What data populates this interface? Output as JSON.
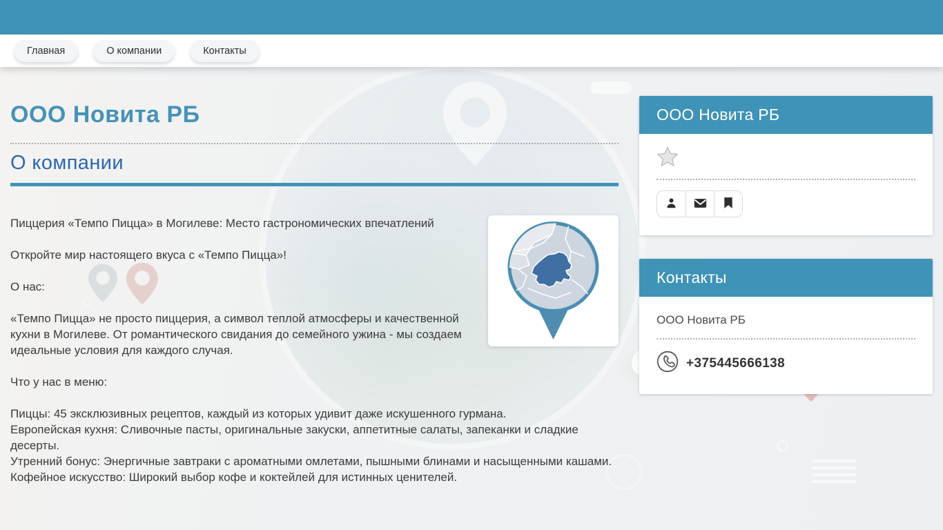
{
  "colors": {
    "accent_teal": "#3e93b7",
    "title_teal": "#4692b8",
    "heading_blue": "#2b68b1",
    "body_text": "#3b3b3b",
    "map_land": "#cdd5df",
    "map_highlight": "#3f6fa3",
    "pin_red": "#cd6a63"
  },
  "nav": {
    "items": [
      {
        "label": "Главная"
      },
      {
        "label": "О компании"
      },
      {
        "label": "Контакты"
      }
    ]
  },
  "main": {
    "title": "ООО Новита РБ",
    "section_heading": "О компании",
    "paragraphs": {
      "p1": "Пиццерия «Темпо Пицца» в Могилеве: Место гастрономических впечатлений",
      "p2": "Откройте мир настоящего вкуса с «Темпо Пицца»!",
      "p3": "О нас:",
      "p4": "«Темпо Пицца» не просто пиццерия, а символ теплой атмосферы и качественной кухни в Могилеве. От романтического свидания до семейного ужина - мы создаем идеальные условия для каждого случая.",
      "p5": "Что у нас в меню:",
      "menu": "Пиццы: 45 эксклюзивных рецептов, каждый из которых удивит даже искушенного гурмана.\nЕвропейская кухня: Сливочные пасты, оригинальные закуски, аппетитные салаты, запеканки и сладкие десерты.\nУтренний бонус: Энергичные завтраки с ароматными омлетами, пышными блинами и насыщенными кашами.\nКофейное искусство: Широкий выбор кофе и коктейлей для истинных ценителей."
    }
  },
  "map_widget": {
    "description": "круглая карта с выделенной Беларусью и указателем",
    "icons": [
      "map-circle",
      "belarus-shape",
      "map-pointer"
    ]
  },
  "sidebar": {
    "company_card": {
      "title": "ООО Новита РБ",
      "icons": [
        "star-icon",
        "person-icon",
        "envelope-icon",
        "bookmark-icon"
      ]
    },
    "contacts_card": {
      "title": "Контакты",
      "company_name": "ООО Новита РБ",
      "phone": "+375445666138",
      "icons": [
        "phone-icon"
      ]
    }
  }
}
